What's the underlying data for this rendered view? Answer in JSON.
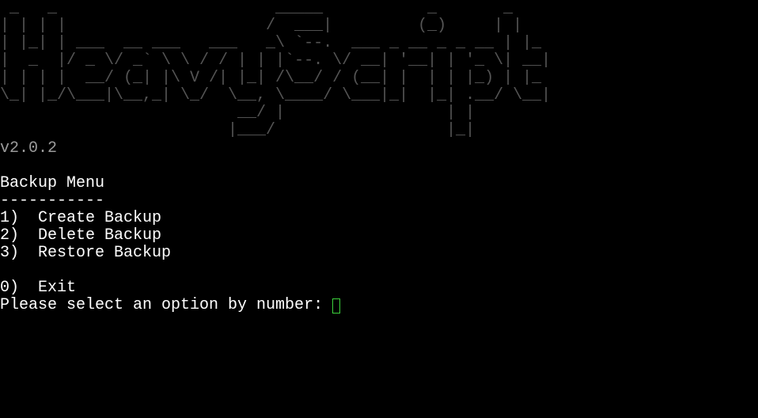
{
  "banner_lines": [
    " _   _                       _____           _       _   ",
    "| | | |                     /  ___|         (_)     | |  ",
    "| |_| | ___  __ ___   ___   _\\ `--.  ___ _ __ _ _ __ | |_ ",
    "|  _  |/ _ \\/ _` \\ \\ / / | | |`--. \\/ __| '__| | '_ \\| __|",
    "| | | |  __/ (_| |\\ V /| |_| /\\__/ / (__| |  | | |_) | |_ ",
    "\\_| |_/\\___|\\__,_| \\_/  \\__, \\____/ \\___|_|  |_| .__/ \\__|",
    "                         __/ |                 | |       ",
    "                        |___/                  |_|       "
  ],
  "version": "v2.0.2",
  "menu": {
    "title": "Backup Menu",
    "divider": "-----------",
    "options": [
      "1)  Create Backup",
      "2)  Delete Backup",
      "3)  Restore Backup"
    ],
    "exit": "0)  Exit"
  },
  "prompt": "Please select an option by number: ",
  "colors": {
    "background": "#000000",
    "text": "#ffffff",
    "cursor": "#3cd23c",
    "version": "#9a9a9a"
  }
}
